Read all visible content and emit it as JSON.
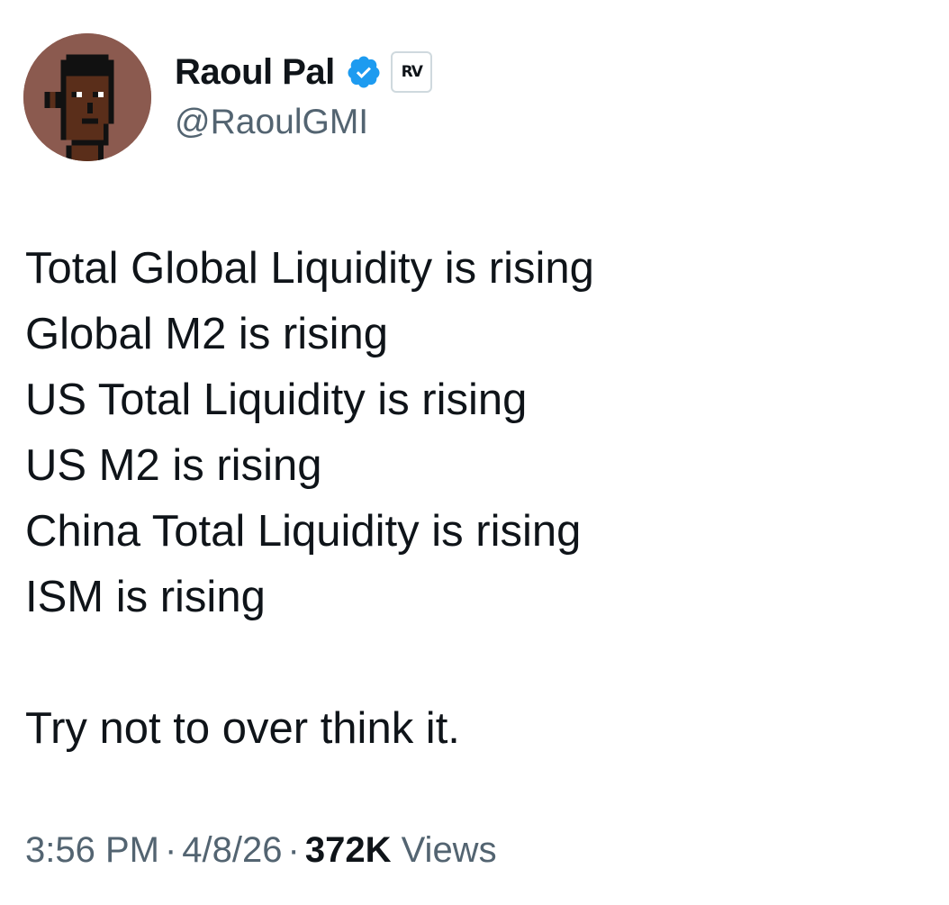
{
  "author": {
    "display_name": "Raoul Pal",
    "handle": "@RaoulGMI",
    "verified_icon": "verified-badge-icon",
    "affiliate_badge": "RV",
    "avatar_icon": "pixel-punk-avatar"
  },
  "tweet": {
    "lines": [
      "Total Global Liquidity is rising",
      "Global M2 is rising",
      "US Total Liquidity is rising",
      "US M2 is rising",
      "China Total Liquidity is rising",
      "ISM is rising"
    ],
    "closing": "Try not to over think it."
  },
  "meta": {
    "time": "3:56 PM",
    "separator": "·",
    "date": "4/8/26",
    "views_count": "372K",
    "views_label": "Views"
  },
  "colors": {
    "text_primary": "#0f1419",
    "text_secondary": "#536471",
    "verified_blue": "#1d9bf0",
    "avatar_bg": "#8b5a4f"
  }
}
